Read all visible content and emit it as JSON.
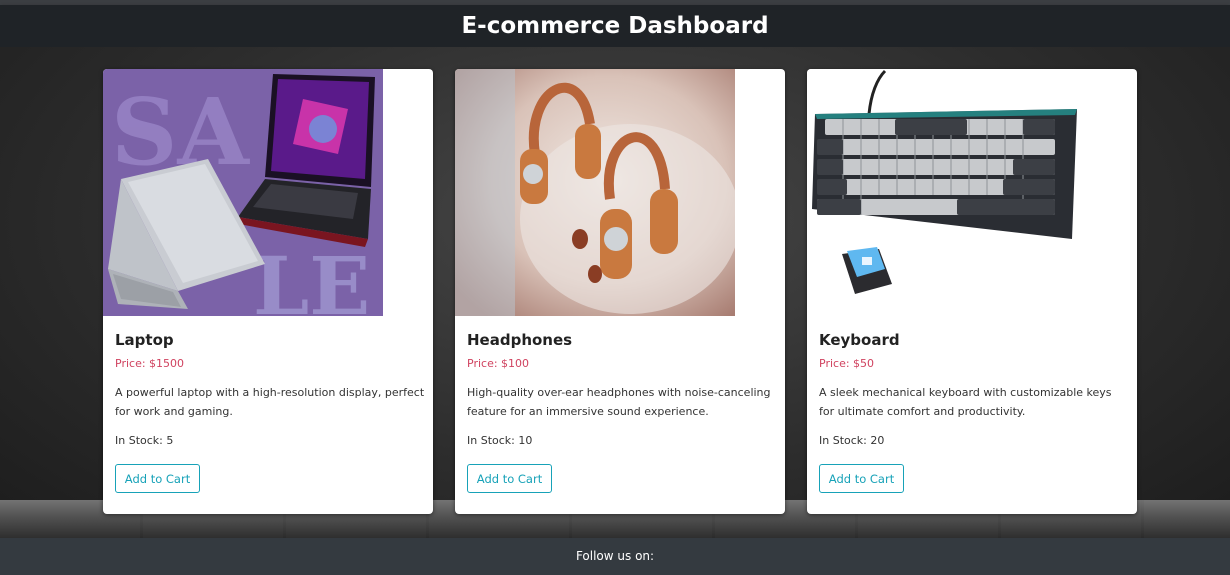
{
  "header": {
    "title": "E-commerce Dashboard"
  },
  "products": [
    {
      "name": "Laptop",
      "price": "Price: $1500",
      "description": "A powerful laptop with a high-resolution display, perfect for work and gaming.",
      "stock": "In Stock: 5",
      "button": "Add to Cart",
      "image_icon": "laptop-image"
    },
    {
      "name": "Headphones",
      "price": "Price: $100",
      "description": "High-quality over-ear headphones with noise-canceling feature for an immersive sound experience.",
      "stock": "In Stock: 10",
      "button": "Add to Cart",
      "image_icon": "headphones-image"
    },
    {
      "name": "Keyboard",
      "price": "Price: $50",
      "description": "A sleek mechanical keyboard with customizable keys for ultimate comfort and productivity.",
      "stock": "In Stock: 20",
      "button": "Add to Cart",
      "image_icon": "keyboard-image"
    }
  ],
  "footer": {
    "text": "Follow us on:"
  },
  "colors": {
    "accent": "#17a2b8",
    "price": "#d0425f",
    "header_bg": "#1f2327",
    "footer_bg": "#343a40"
  }
}
